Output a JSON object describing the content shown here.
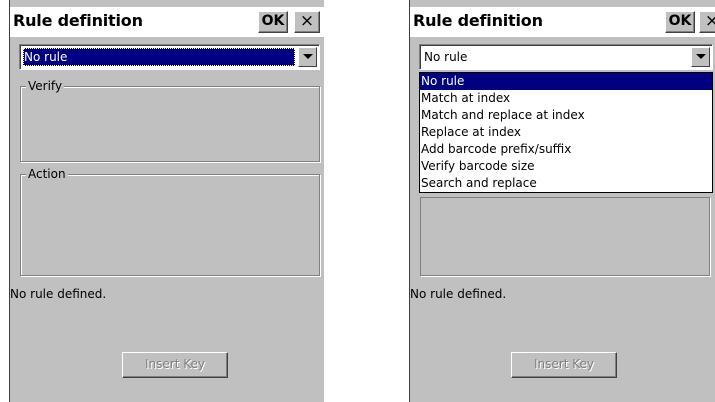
{
  "left_screen": {
    "title": "Rule definition",
    "ok_label": "OK",
    "close_label": "×",
    "combo_value": "No rule",
    "verify_label": "Verify",
    "action_label": "Action",
    "status_text": "No rule defined.",
    "insert_key_label": "Insert Key"
  },
  "right_screen": {
    "title": "Rule definition",
    "ok_label": "OK",
    "close_label": "×",
    "combo_value": "No rule",
    "dropdown_options": [
      "No rule",
      "Match at index",
      "Match and replace at index",
      "Replace at index",
      "Add barcode prefix/suffix",
      "Verify barcode size",
      "Search and replace"
    ],
    "highlighted_option": "No rule",
    "status_text": "No rule defined.",
    "insert_key_label": "Insert Key"
  },
  "colors": {
    "window_bg": "#c0c0c0",
    "selection": "#000080",
    "title_bg": "#ffffff"
  }
}
